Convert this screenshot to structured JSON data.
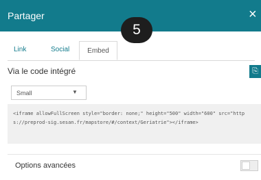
{
  "header": {
    "title": "Partager",
    "close_icon": "×",
    "close_icon_name": "close-icon",
    "accent_color": "#127b8c"
  },
  "step_badge": "5",
  "tabs": [
    {
      "label": "Link",
      "active": false
    },
    {
      "label": "Social",
      "active": false
    },
    {
      "label": "Embed",
      "active": true
    }
  ],
  "embed": {
    "section_title": "Via le code intégré",
    "copy_icon": "⎘",
    "copy_icon_name": "copy-icon",
    "size_select": {
      "value": "Small",
      "caret": "▼"
    },
    "code": "<iframe allowFullScreen style=\"border: none;\" height=\"500\" width=\"600\" src=\"https://preprod-sig.sesan.fr/mapstore/#/context/Geriatrie\"></iframe>"
  },
  "options": {
    "label": "Options avancées",
    "toggle_on": false
  }
}
